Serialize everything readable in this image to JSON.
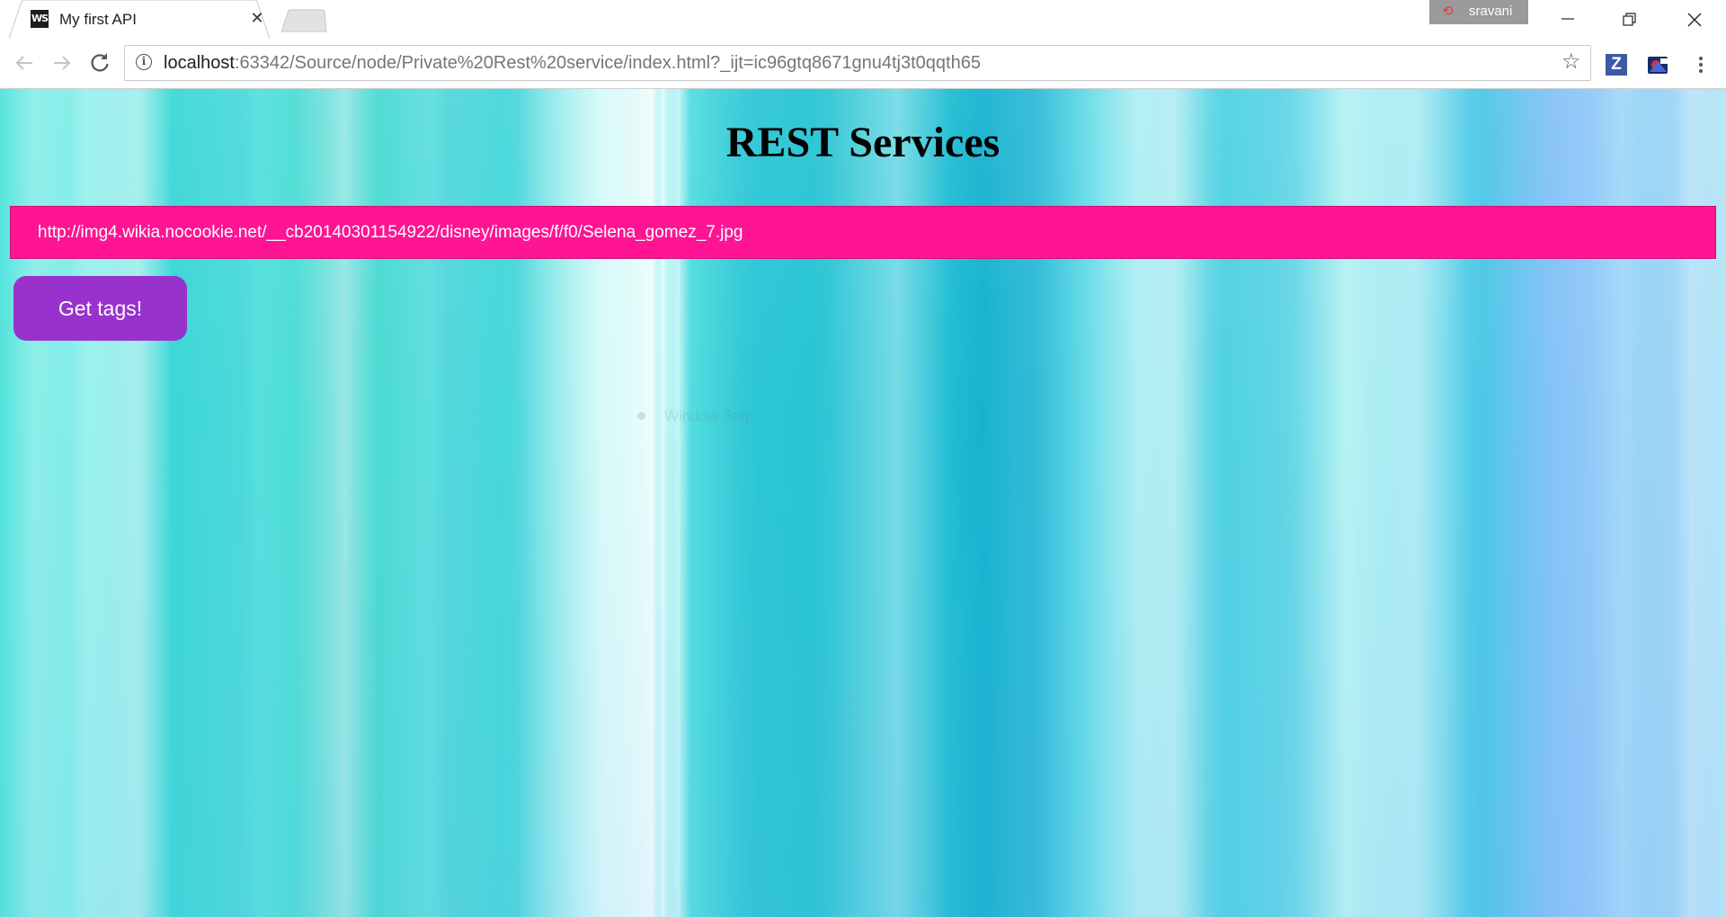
{
  "browser": {
    "tab": {
      "favicon_text": "WS",
      "title": "My first API"
    },
    "profile": {
      "name": "sravani"
    },
    "address_bar": {
      "host": "localhost",
      "rest": ":63342/Source/node/Private%20Rest%20service/index.html?_ijt=ic96gtq8671gnu4tj3t0qqth65"
    },
    "extensions": {
      "z_label": "Z"
    }
  },
  "page": {
    "title": "REST Services",
    "image_url_value": "http://img4.wikia.nocookie.net/__cb20140301154922/disney/images/f/f0/Selena_gomez_7.jpg",
    "submit_label": "Get tags!",
    "overlay_text": "Window Snip"
  },
  "colors": {
    "input_background": "#ff1493",
    "button_background": "#9932cc"
  }
}
